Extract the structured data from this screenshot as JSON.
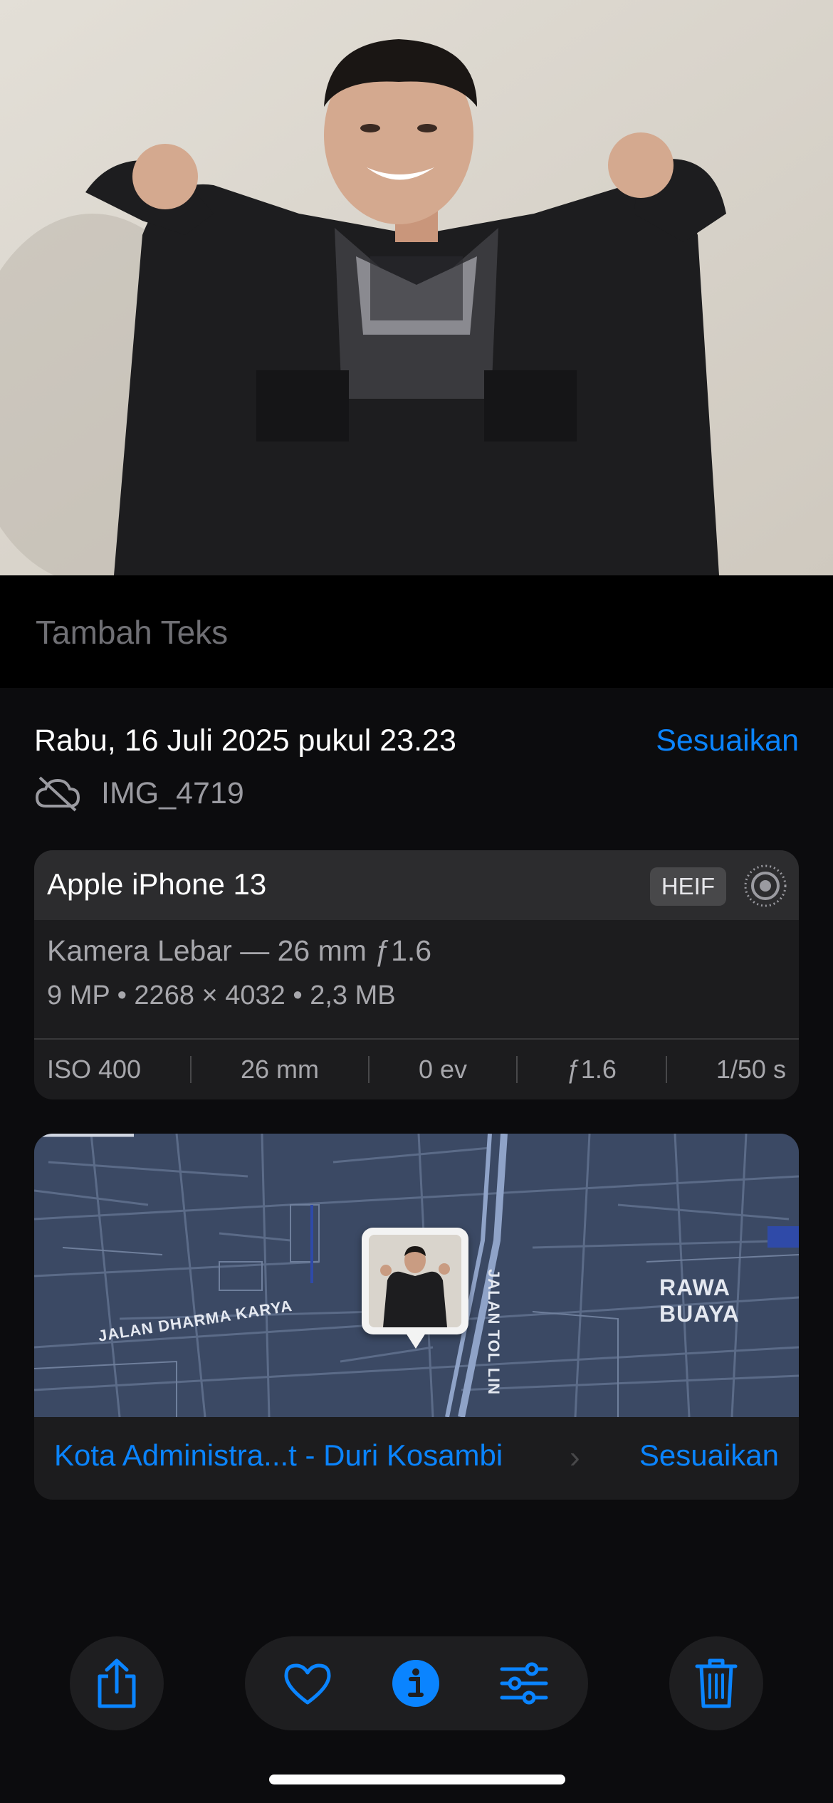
{
  "caption": {
    "placeholder": "Tambah Teks"
  },
  "info": {
    "date": "Rabu, 16 Juli 2025 pukul 23.23",
    "adjust_label": "Sesuaikan",
    "filename": "IMG_4719",
    "cloud_icon": "cloud-off-icon"
  },
  "exif": {
    "device": "Apple iPhone 13",
    "format": "HEIF",
    "live_icon": "live-photo-icon",
    "lens": "Kamera Lebar — 26 mm ƒ1.6",
    "specs": "9 MP • 2268 × 4032 • 2,3 MB",
    "stats": [
      "ISO 400",
      "26 mm",
      "0 ev",
      "ƒ1.6",
      "1/50 s"
    ]
  },
  "map": {
    "labels": {
      "area": "RAWA BUAYA",
      "street": "JALAN DHARMA KARYA",
      "toll": "JALAN TOL LIN"
    },
    "location": "Kota Administra...t - Duri Kosambi",
    "chevron": "›",
    "adjust_label": "Sesuaikan"
  },
  "toolbar": {
    "icons": [
      "share-icon",
      "heart-icon",
      "info-icon",
      "adjust-sliders-icon",
      "trash-icon"
    ]
  },
  "colors": {
    "accent": "#0a84ff",
    "background": "#0c0c0e",
    "card": "#1c1c1e",
    "map": "#3b4964"
  }
}
